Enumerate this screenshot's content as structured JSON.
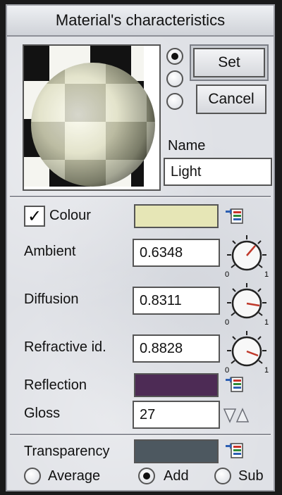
{
  "window": {
    "title": "Material's characteristics"
  },
  "top": {
    "set_label": "Set",
    "cancel_label": "Cancel",
    "name_label": "Name",
    "name_value": "Light",
    "selected_radio": 0
  },
  "props": {
    "colour_label": "Colour",
    "colour_checked": true,
    "colour_value": "#e6e6b6",
    "ambient_label": "Ambient",
    "ambient_value": "0.6348",
    "diffusion_label": "Diffusion",
    "diffusion_value": "0.8311",
    "refractive_label": "Refractive id.",
    "refractive_value": "0.8828",
    "dial_min": "0",
    "dial_max": "1",
    "reflection_label": "Reflection",
    "reflection_value": "#4d2b55",
    "gloss_label": "Gloss",
    "gloss_value": "27"
  },
  "bottom": {
    "transparency_label": "Transparency",
    "transparency_value": "#4d5860",
    "average_label": "Average",
    "add_label": "Add",
    "sub_label": "Sub",
    "selected_mode": "Add"
  },
  "colors": {
    "checker_dark": "#121212",
    "checker_light": "#f5f5f0",
    "dial_needle": "#c0392b",
    "icon_red": "#c8322a",
    "icon_green": "#2e8b3a",
    "icon_blue": "#2d5fb3"
  }
}
